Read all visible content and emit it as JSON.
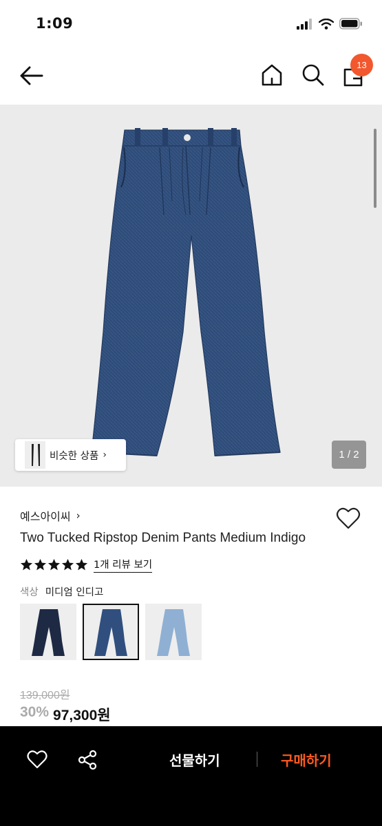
{
  "status": {
    "time": "1:09"
  },
  "nav": {
    "cart_count": "13"
  },
  "gallery": {
    "similar_label": "비슷한 상품",
    "pager": "1 / 2"
  },
  "product": {
    "brand": "예스아이씨",
    "title": "Two Tucked Ripstop Denim Pants Medium Indigo",
    "rating": 5,
    "review_link": "1개 리뷰 보기",
    "color_label": "색상",
    "color_value": "미디엄 인디고",
    "swatches": [
      {
        "name": "dark-indigo",
        "color": "#1e2a44"
      },
      {
        "name": "medium-indigo",
        "color": "#304f7e"
      },
      {
        "name": "light-blue",
        "color": "#8fb0d3"
      }
    ],
    "selected_swatch": 1,
    "original_price": "139,000원",
    "discount": "30%",
    "price": "97,300원"
  },
  "actions": {
    "gift": "선물하기",
    "buy": "구매하기"
  },
  "colors": {
    "accent": "#f2572d",
    "buy": "#ff5a1f",
    "denim": "#2f4c78"
  }
}
